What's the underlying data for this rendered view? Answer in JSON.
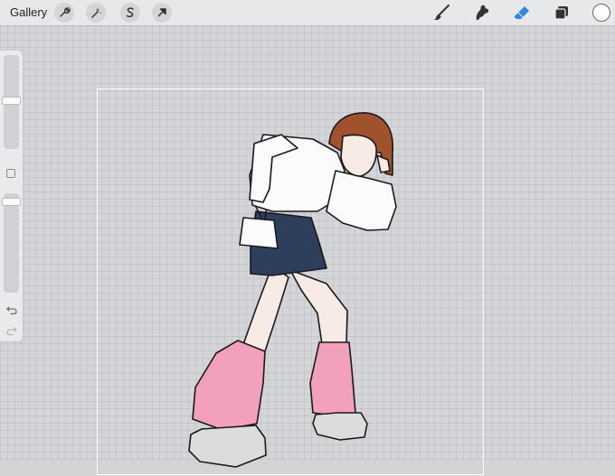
{
  "toolbar": {
    "gallery_label": "Gallery",
    "left_tools": [
      {
        "name": "actions",
        "icon": "wrench-icon"
      },
      {
        "name": "adjustments",
        "icon": "magic-wand-icon"
      },
      {
        "name": "selection",
        "icon": "selection-s-icon"
      },
      {
        "name": "transform",
        "icon": "arrow-cursor-icon"
      }
    ],
    "right_tools": [
      {
        "name": "brush",
        "icon": "brush-icon",
        "active": false
      },
      {
        "name": "smudge",
        "icon": "smudge-icon",
        "active": false
      },
      {
        "name": "eraser",
        "icon": "eraser-icon",
        "active": true
      },
      {
        "name": "layers",
        "icon": "layers-icon",
        "active": false
      }
    ],
    "current_color": "#ffffff",
    "accent_color": "#2f86e0"
  },
  "sidebar": {
    "brush_size_level": 0.52,
    "opacity_level": 0.95,
    "buttons": [
      "modify-icon",
      "undo-icon",
      "redo-icon"
    ]
  },
  "artwork": {
    "subject": "girl-figure-drawing",
    "colors": {
      "hair": "#a0522d",
      "skin": "#f8ebe5",
      "shirt": "#fbfbfb",
      "skirt": "#2d3f5c",
      "leg_warmers": "#f2a0bb",
      "shoes": "#d8d8d8",
      "line": "#1a1a1a"
    }
  }
}
